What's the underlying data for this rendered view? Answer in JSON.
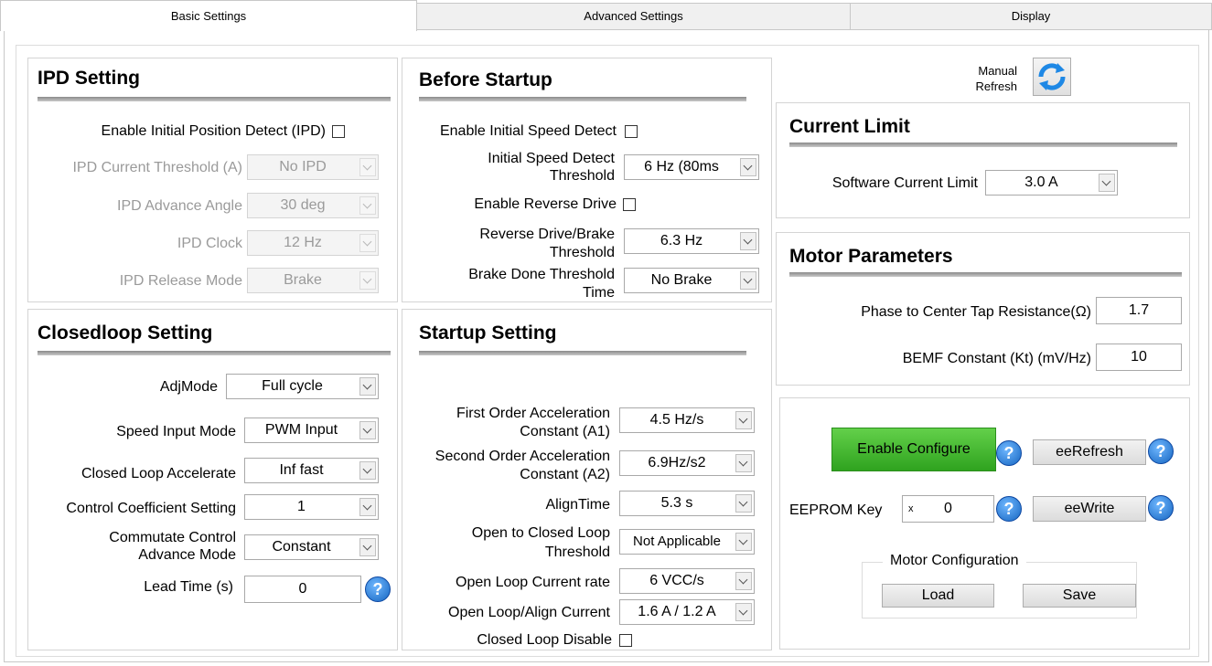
{
  "tabs": [
    "Basic Settings",
    "Advanced Settings",
    "Display"
  ],
  "ipd": {
    "title": "IPD Setting",
    "enable_label": "Enable Initial Position Detect (IPD)",
    "current_threshold_label": "IPD Current Threshold (A)",
    "current_threshold_value": "No IPD",
    "advance_angle_label": "IPD Advance Angle",
    "advance_angle_value": "30 deg",
    "clock_label": "IPD Clock",
    "clock_value": "12 Hz",
    "release_mode_label": "IPD Release Mode",
    "release_mode_value": "Brake"
  },
  "before_startup": {
    "title": "Before Startup",
    "enable_speed_detect_label": "Enable Initial Speed Detect",
    "speed_detect_threshold_label_1": "Initial Speed Detect",
    "speed_detect_threshold_label_2": "Threshold",
    "speed_detect_threshold_value": "6 Hz (80ms",
    "enable_reverse_label": "Enable Reverse Drive",
    "reverse_threshold_label_1": "Reverse Drive/Brake",
    "reverse_threshold_label_2": "Threshold",
    "reverse_threshold_value": "6.3 Hz",
    "brake_done_label_1": "Brake Done Threshold",
    "brake_done_label_2": "Time",
    "brake_done_value": "No Brake"
  },
  "closedloop": {
    "title": "Closedloop Setting",
    "adjmode_label": "AdjMode",
    "adjmode_value": "Full cycle",
    "speed_input_label": "Speed Input Mode",
    "speed_input_value": "PWM Input",
    "accelerate_label": "Closed Loop Accelerate",
    "accelerate_value": "Inf fast",
    "coefficient_label": "Control Coefficient Setting",
    "coefficient_value": "1",
    "commutate_label_1": "Commutate Control",
    "commutate_label_2": "Advance Mode",
    "commutate_value": "Constant",
    "lead_time_label": "Lead Time (s)",
    "lead_time_value": "0"
  },
  "startup": {
    "title": "Startup Setting",
    "a1_label_1": "First Order Acceleration",
    "a1_label_2": "Constant (A1)",
    "a1_value": "4.5 Hz/s",
    "a2_label_1": "Second Order Acceleration",
    "a2_label_2": "Constant (A2)",
    "a2_value": "6.9Hz/s2",
    "align_time_label": "AlignTime",
    "align_time_value": "5.3 s",
    "open_closed_label_1": "Open to Closed Loop",
    "open_closed_label_2": "Threshold",
    "open_closed_value": "Not Applicable",
    "current_rate_label": "Open Loop Current rate",
    "current_rate_value": "6 VCC/s",
    "align_current_label": "Open Loop/Align Current",
    "align_current_value": "1.6 A / 1.2 A",
    "closed_loop_disable_label": "Closed Loop Disable"
  },
  "refresh": {
    "label_1": "Manual",
    "label_2": "Refresh"
  },
  "current_limit": {
    "title": "Current Limit",
    "software_label": "Software Current Limit",
    "software_value": "3.0 A"
  },
  "motor_params": {
    "title": "Motor Parameters",
    "resistance_label": "Phase to Center Tap Resistance(Ω)",
    "resistance_value": "1.7",
    "bemf_label": "BEMF Constant (Kt) (mV/Hz)",
    "bemf_value": "10"
  },
  "eeprom": {
    "enable_configure": "Enable Configure",
    "ee_refresh": "eeRefresh",
    "key_label": "EEPROM Key",
    "key_prefix": "x",
    "key_value": "0",
    "ee_write": "eeWrite",
    "help_glyph": "?"
  },
  "motor_config": {
    "title": "Motor Configuration",
    "load": "Load",
    "save": "Save"
  }
}
